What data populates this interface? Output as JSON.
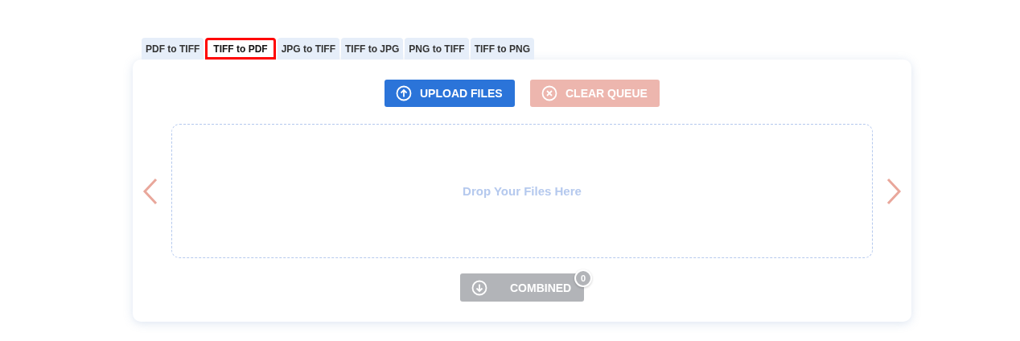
{
  "tabs": [
    {
      "label": "PDF to TIFF",
      "selected": false
    },
    {
      "label": "TIFF to PDF",
      "selected": true
    },
    {
      "label": "JPG to TIFF",
      "selected": false
    },
    {
      "label": "TIFF to JPG",
      "selected": false
    },
    {
      "label": "PNG to TIFF",
      "selected": false
    },
    {
      "label": "TIFF to PNG",
      "selected": false
    }
  ],
  "upload_button": {
    "label": "UPLOAD FILES",
    "disabled": false
  },
  "clear_button": {
    "label": "CLEAR QUEUE",
    "disabled": true
  },
  "drop_zone": {
    "text": "Drop Your Files Here"
  },
  "combined_button": {
    "label": "COMBINED",
    "disabled": true,
    "count": "0"
  }
}
